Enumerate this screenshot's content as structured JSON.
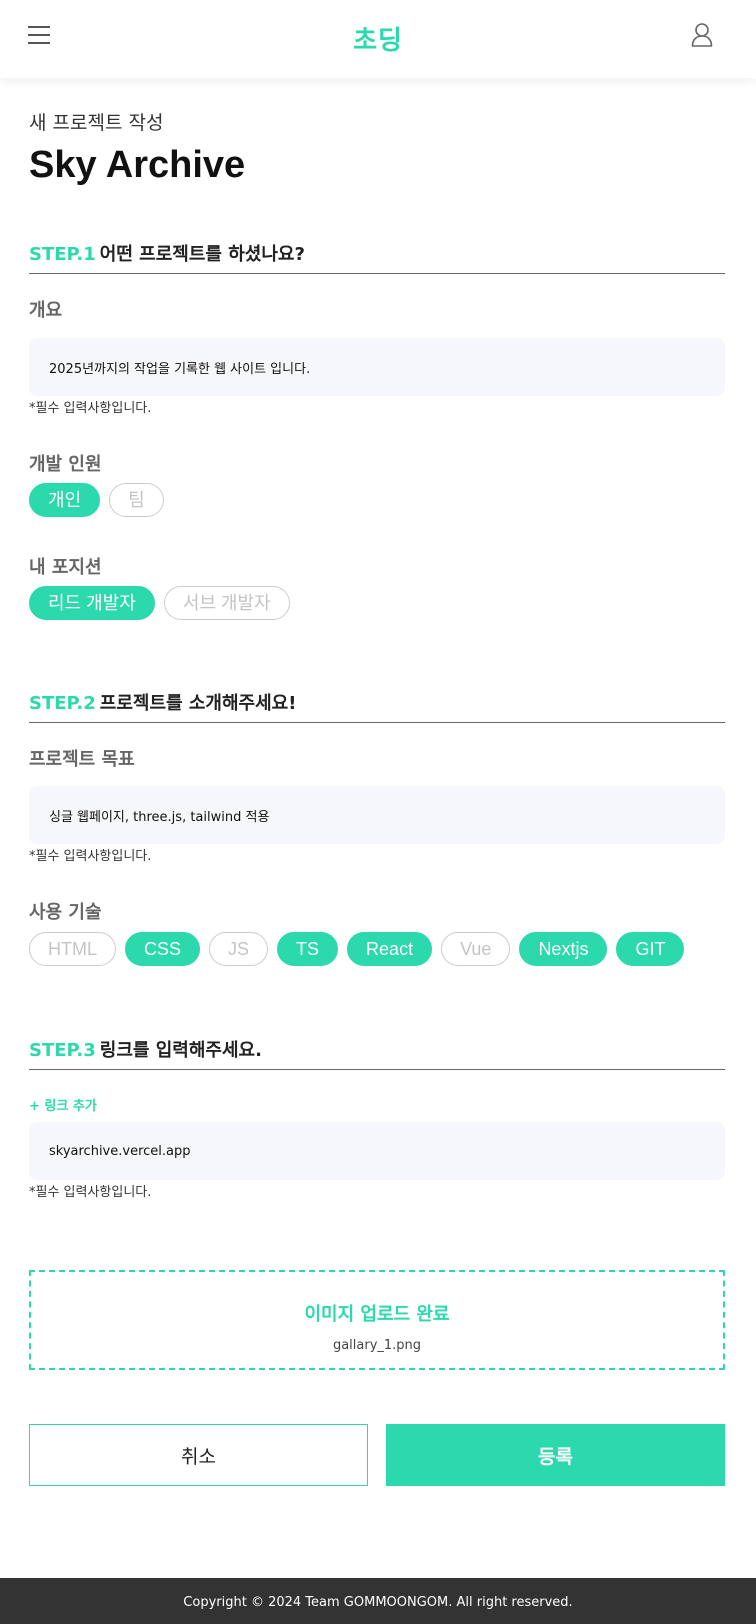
{
  "header": {
    "logo": "초딩",
    "menu_icon": "hamburger-menu-icon",
    "user_icon": "user-profile-icon"
  },
  "page": {
    "subtitle": "새 프로젝트 작성",
    "title": "Sky Archive"
  },
  "step1": {
    "num": "STEP.1",
    "text": "어떤 프로젝트를 하셨나요?",
    "overview_label": "개요",
    "overview_value": "2025년까지의 작업을 기록한 웹 사이트 입니다.",
    "required_note": "*필수 입력사항입니다.",
    "team_label": "개발 인원",
    "team_options": [
      {
        "label": "개인",
        "selected": true
      },
      {
        "label": "팀",
        "selected": false
      }
    ],
    "position_label": "내 포지션",
    "position_options": [
      {
        "label": "리드 개발자",
        "selected": true
      },
      {
        "label": "서브 개발자",
        "selected": false
      }
    ]
  },
  "step2": {
    "num": "STEP.2",
    "text": "프로젝트를 소개해주세요!",
    "goal_label": "프로젝트 목표",
    "goal_value": "싱글 웹페이지, three.js, tailwind 적용",
    "required_note": "*필수 입력사항입니다.",
    "tech_label": "사용 기술",
    "tech_options": [
      {
        "label": "HTML",
        "selected": false
      },
      {
        "label": "CSS",
        "selected": true
      },
      {
        "label": "JS",
        "selected": false
      },
      {
        "label": "TS",
        "selected": true
      },
      {
        "label": "React",
        "selected": true
      },
      {
        "label": "Vue",
        "selected": false
      },
      {
        "label": "Nextjs",
        "selected": true
      },
      {
        "label": "GIT",
        "selected": true
      }
    ]
  },
  "step3": {
    "num": "STEP.3",
    "text": "링크를 입력해주세요.",
    "add_link": "+ 링크 추가",
    "link_value": "skyarchive.vercel.app",
    "required_note": "*필수 입력사항입니다."
  },
  "upload": {
    "title": "이미지 업로드 완료",
    "filename": "gallary_1.png"
  },
  "actions": {
    "cancel": "취소",
    "submit": "등록"
  },
  "footer": {
    "copyright": "Copyright © 2024 Team GOMMOONGOM. All right reserved."
  },
  "colors": {
    "accent": "#2bd9ac",
    "footer_bg": "#333333"
  }
}
